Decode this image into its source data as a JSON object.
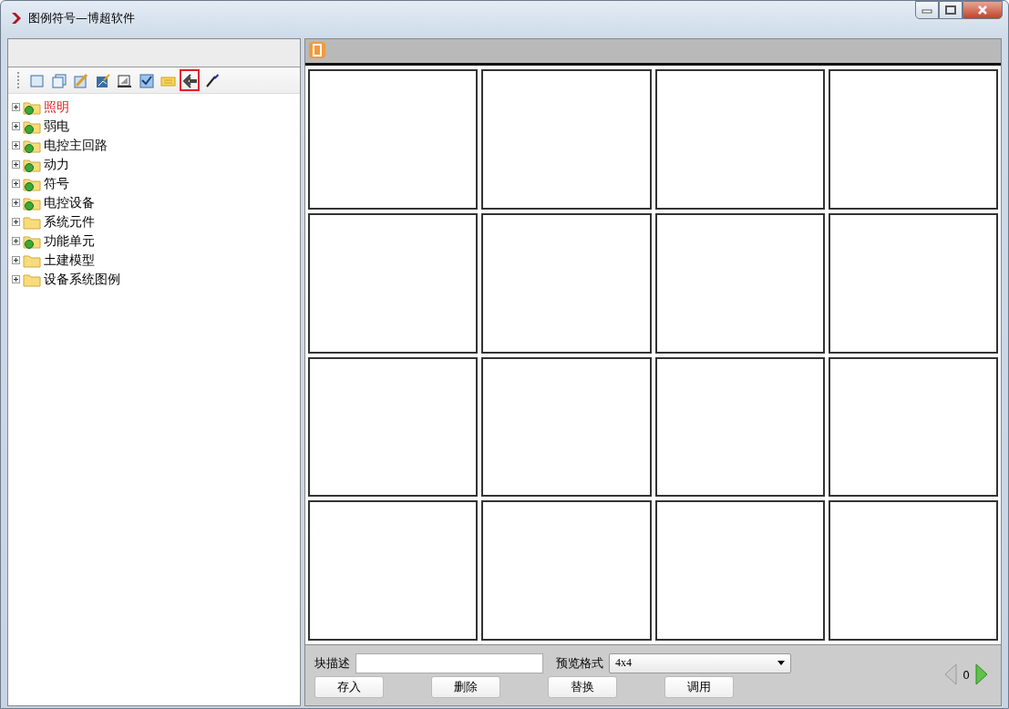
{
  "window": {
    "title": "图例符号—博超软件"
  },
  "toolbar": [
    {
      "kind": "page",
      "selected": false
    },
    {
      "kind": "pages",
      "selected": false
    },
    {
      "kind": "brush",
      "selected": false
    },
    {
      "kind": "image",
      "selected": false
    },
    {
      "kind": "ruler",
      "selected": false
    },
    {
      "kind": "check",
      "selected": false
    },
    {
      "kind": "note",
      "selected": false
    },
    {
      "kind": "back",
      "selected": true
    },
    {
      "kind": "pen",
      "selected": false
    }
  ],
  "tree": [
    {
      "label": "照明",
      "selected": true,
      "badge": true
    },
    {
      "label": "弱电",
      "selected": false,
      "badge": true
    },
    {
      "label": "电控主回路",
      "selected": false,
      "badge": true
    },
    {
      "label": "动力",
      "selected": false,
      "badge": true
    },
    {
      "label": "符号",
      "selected": false,
      "badge": true
    },
    {
      "label": "电控设备",
      "selected": false,
      "badge": true
    },
    {
      "label": "系统元件",
      "selected": false,
      "badge": false
    },
    {
      "label": "功能单元",
      "selected": false,
      "badge": true
    },
    {
      "label": "土建模型",
      "selected": false,
      "badge": false
    },
    {
      "label": "设备系统图例",
      "selected": false,
      "badge": false
    }
  ],
  "bottom": {
    "desc_label": "块描述",
    "format_label": "预览格式",
    "format_value": "4x4",
    "buttons": [
      "存入",
      "删除",
      "替换",
      "调用"
    ],
    "page": "0",
    "prev_disabled": true,
    "next_disabled": false
  }
}
